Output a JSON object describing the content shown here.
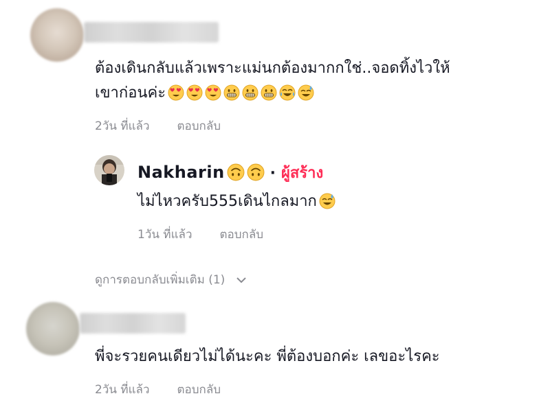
{
  "comments": [
    {
      "text": "ต้องเดินกลับแล้วเพราะแม่นกต้องมากกใช่..จอดทิ้งไวให้",
      "text_line2": "เขาก่อนค่ะ",
      "emoji": [
        "heart-eyes-icon",
        "heart-eyes-icon",
        "heart-eyes-icon",
        "grin-icon",
        "grin-icon",
        "grin-icon",
        "tears-of-joy-icon",
        "sweat-smile-icon"
      ],
      "time": "2วัน ที่แล้ว",
      "reply_label": "ตอบกลับ"
    },
    {
      "text": "พี่จะรวยคนเดียวไม่ได้นะคะ พี่ต้องบอกค่ะ เลขอะไรคะ",
      "time": "2วัน ที่แล้ว",
      "reply_label": "ตอบกลับ"
    }
  ],
  "reply": {
    "author": "Nakharin",
    "author_emoji": [
      "upside-down-face-icon",
      "upside-down-face-icon"
    ],
    "separator": "·",
    "creator_label": "ผู้สร้าง",
    "text": "ไม่ไหวครับ555เดินไกลมาก",
    "text_emoji": "sweat-smile-icon",
    "time": "1วัน ที่แล้ว",
    "reply_label": "ตอบกลับ"
  },
  "view_more": "ดูการตอบกลับเพิ่มเติม (1)",
  "colors": {
    "creator": "#fe2c55",
    "meta": "#8a8b91",
    "text": "#161823"
  }
}
